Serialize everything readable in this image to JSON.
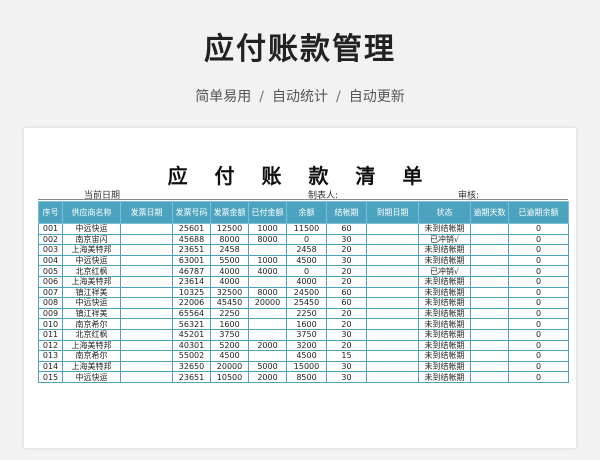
{
  "header": {
    "title": "应付账款管理",
    "subtitle_items": [
      "简单易用",
      "自动统计",
      "自动更新"
    ],
    "separator": "/"
  },
  "sheet": {
    "title": "应 付 账 款 清 单",
    "current_date_label": "当前日期",
    "preparer_label": "制表人:",
    "reviewer_label": "审核:"
  },
  "table": {
    "columns": [
      "序号",
      "供应商名称",
      "发票日期",
      "发票号码",
      "发票金额",
      "已付金额",
      "余额",
      "结帐期",
      "到期日期",
      "状态",
      "逾期天数",
      "已逾期余额"
    ],
    "rows": [
      [
        "001",
        "中远快运",
        "",
        "25601",
        "12500",
        "1000",
        "11500",
        "60",
        "",
        "未到结帐期",
        "",
        "0"
      ],
      [
        "002",
        "南京宙闪",
        "",
        "45688",
        "8000",
        "8000",
        "0",
        "30",
        "",
        "已冲销√",
        "",
        "0"
      ],
      [
        "003",
        "上海美特邦",
        "",
        "23651",
        "2458",
        "",
        "2458",
        "20",
        "",
        "未到结帐期",
        "",
        "0"
      ],
      [
        "004",
        "中远快运",
        "",
        "63001",
        "5500",
        "1000",
        "4500",
        "30",
        "",
        "未到结帐期",
        "",
        "0"
      ],
      [
        "005",
        "北京红枫",
        "",
        "46787",
        "4000",
        "4000",
        "0",
        "20",
        "",
        "已冲销√",
        "",
        "0"
      ],
      [
        "006",
        "上海美特邦",
        "",
        "23614",
        "4000",
        "",
        "4000",
        "20",
        "",
        "未到结帐期",
        "",
        "0"
      ],
      [
        "007",
        "镇江祥美",
        "",
        "10325",
        "32500",
        "8000",
        "24500",
        "60",
        "",
        "未到结帐期",
        "",
        "0"
      ],
      [
        "008",
        "中远快运",
        "",
        "22006",
        "45450",
        "20000",
        "25450",
        "60",
        "",
        "未到结帐期",
        "",
        "0"
      ],
      [
        "009",
        "镇江祥美",
        "",
        "65564",
        "2250",
        "",
        "2250",
        "20",
        "",
        "未到结帐期",
        "",
        "0"
      ],
      [
        "010",
        "南京希尔",
        "",
        "56321",
        "1600",
        "",
        "1600",
        "20",
        "",
        "未到结帐期",
        "",
        "0"
      ],
      [
        "011",
        "北京红枫",
        "",
        "45201",
        "3750",
        "",
        "3750",
        "30",
        "",
        "未到结帐期",
        "",
        "0"
      ],
      [
        "012",
        "上海美特邦",
        "",
        "40301",
        "5200",
        "2000",
        "3200",
        "20",
        "",
        "未到结帐期",
        "",
        "0"
      ],
      [
        "013",
        "南京希尔",
        "",
        "55002",
        "4500",
        "",
        "4500",
        "15",
        "",
        "未到结帐期",
        "",
        "0"
      ],
      [
        "014",
        "上海美特邦",
        "",
        "32650",
        "20000",
        "5000",
        "15000",
        "30",
        "",
        "未到结帐期",
        "",
        "0"
      ],
      [
        "015",
        "中远快运",
        "",
        "23651",
        "10500",
        "2000",
        "8500",
        "30",
        "",
        "未到结帐期",
        "",
        "0"
      ]
    ]
  }
}
